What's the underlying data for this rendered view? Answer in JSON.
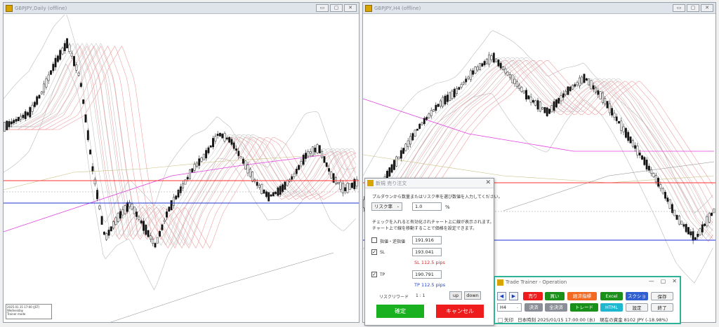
{
  "left_window": {
    "title": "GBPJPY,Daily (offline)",
    "info_lines": [
      "2025.01.15 17:00 (JST)",
      "Wednesday",
      "Trainer mode"
    ]
  },
  "right_window": {
    "title": "GBPJPY,H4 (offline)"
  },
  "window_buttons": {
    "minimize": "▭",
    "maximize": "▢",
    "close": "✕"
  },
  "order_dialog": {
    "title": "新規 売り注文",
    "instruction": "プルダウンから数量またはリスク率を選び数値を入力してください。",
    "risk_select": "リスク率",
    "risk_value": "1.0",
    "risk_unit": "%",
    "help1": "チェックを入れると有効化されチャート上に線が表示されます。",
    "help2": "チャート上で線を移動することで価格を設定できます。",
    "stop_label": "指値・逆指値",
    "stop_value": "191.916",
    "sl_label": "SL",
    "sl_value": "193.041",
    "sl_pips": "SL 112.5 pips",
    "tp_label": "TP",
    "tp_value": "190.791",
    "tp_pips": "TP 112.5 pips",
    "reward_label": "リスクリワード",
    "reward_value": "1 : 1",
    "up": "up",
    "down": "down",
    "confirm": "確定",
    "cancel": "キャンセル",
    "close": "✕",
    "check": "✓"
  },
  "trainer": {
    "title": "Trade Trainer - Operation",
    "ctrl_min": "—",
    "ctrl_max": "▢",
    "ctrl_close": "✕",
    "prev": "◀",
    "next": "▶",
    "timeframe": "H4",
    "sell": "売り",
    "buy": "買い",
    "econ": "経済指標",
    "excel": "Excel",
    "screenshot": "スクショ",
    "save": "保存",
    "settle": "決済",
    "settle_all": "全決済",
    "trade": "トレード",
    "html": "HTML",
    "settings": "設定",
    "exit": "終了",
    "arrow_label": "矢印",
    "status": "日本時刻 2025/01/15 17:00:00 (水)　現在の資金 8102 JPY (-18.98%)"
  },
  "colors": {
    "sell": "#ee1c1c",
    "buy": "#1a8f1a",
    "econ": "#f26a22",
    "excel": "#1a8f1a",
    "screenshot": "#2f5fd0",
    "settle": "#8a8f97",
    "trade": "#1a8f1a",
    "html": "#1fb7cf",
    "teal_border": "#2eb39a",
    "sl_line": "#ff3030",
    "tp_line": "#1f2fd6"
  }
}
